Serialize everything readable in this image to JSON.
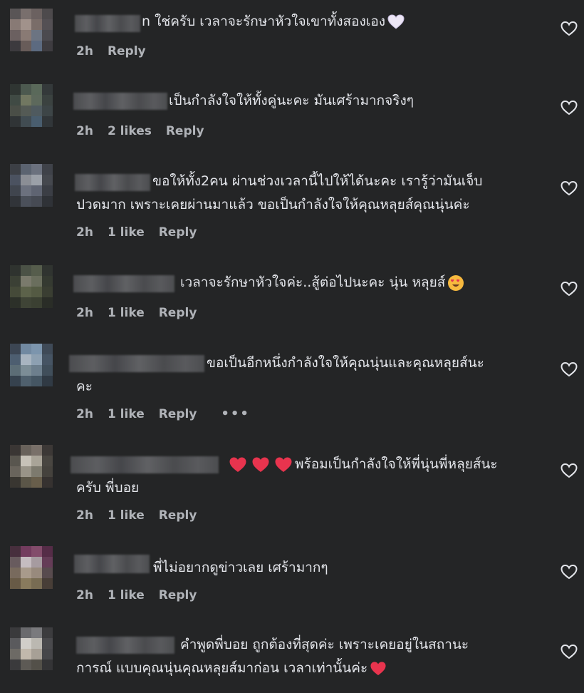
{
  "comments": [
    {
      "text_lines": [
        "n ใช่ครับ เวลาจะรักษาหัวใจเขาทั้งสองเอง"
      ],
      "time": "2h",
      "likes": "",
      "reply": "Reply"
    },
    {
      "text_lines": [
        "เป็นกำลังใจให้ทั้งคู่นะคะ มันเศร้ามากจริงๆ"
      ],
      "time": "2h",
      "likes": "2 likes",
      "reply": "Reply"
    },
    {
      "text_lines": [
        "ขอให้ทั้ง2คน ผ่านช่วงเวลานี้ไปให้ได้นะคะ เรารู้ว่ามันเจ็บ",
        "ปวดมาก เพราะเคยผ่านมาแล้ว ขอเป็นกำลังใจให้คุณหลุยส์คุณนุ่นค่ะ"
      ],
      "time": "2h",
      "likes": "1 like",
      "reply": "Reply"
    },
    {
      "text_lines": [
        "เวลาจะรักษาหัวใจค่ะ..สู้ต่อไปนะคะ นุ่น หลุยส์"
      ],
      "time": "2h",
      "likes": "1 like",
      "reply": "Reply"
    },
    {
      "text_lines": [
        "ขอเป็นอีกหนึ่งกำลังใจให้คุณนุ่นและคุณหลุยส์นะ",
        "คะ"
      ],
      "time": "2h",
      "likes": "1 like",
      "reply": "Reply",
      "more": "•••"
    },
    {
      "text_lines": [
        "พร้อมเป็นกำลังใจให้พี่นุ่นพี่หลุยส์นะ",
        "ครับ พี่บอย"
      ],
      "time": "2h",
      "likes": "1 like",
      "reply": "Reply"
    },
    {
      "text_lines": [
        "พี่ไม่อยากดูข่าวเลย เศร้ามากๆ"
      ],
      "time": "2h",
      "likes": "1 like",
      "reply": "Reply"
    },
    {
      "text_lines": [
        "คำพูดพี่บอย ถูกต้องที่สุดค่ะ เพราะเคยอยู่ในสถานะ",
        "การณ์ แบบคุณนุ่นคุณหลุยส์มาก่อน เวลาเท่านั้นค่ะ"
      ],
      "time": "",
      "likes": "",
      "reply": ""
    }
  ],
  "icons": {
    "like": "heart-outline-icon",
    "emoji_white_heart": "white-heart-emoji",
    "emoji_red_heart": "red-heart-emoji",
    "emoji_heart_eyes": "heart-eyes-emoji"
  },
  "colors": {
    "background": "#242526",
    "text": "#e4e6eb",
    "muted": "#b0b3b8",
    "red_heart": "#e8344e"
  }
}
